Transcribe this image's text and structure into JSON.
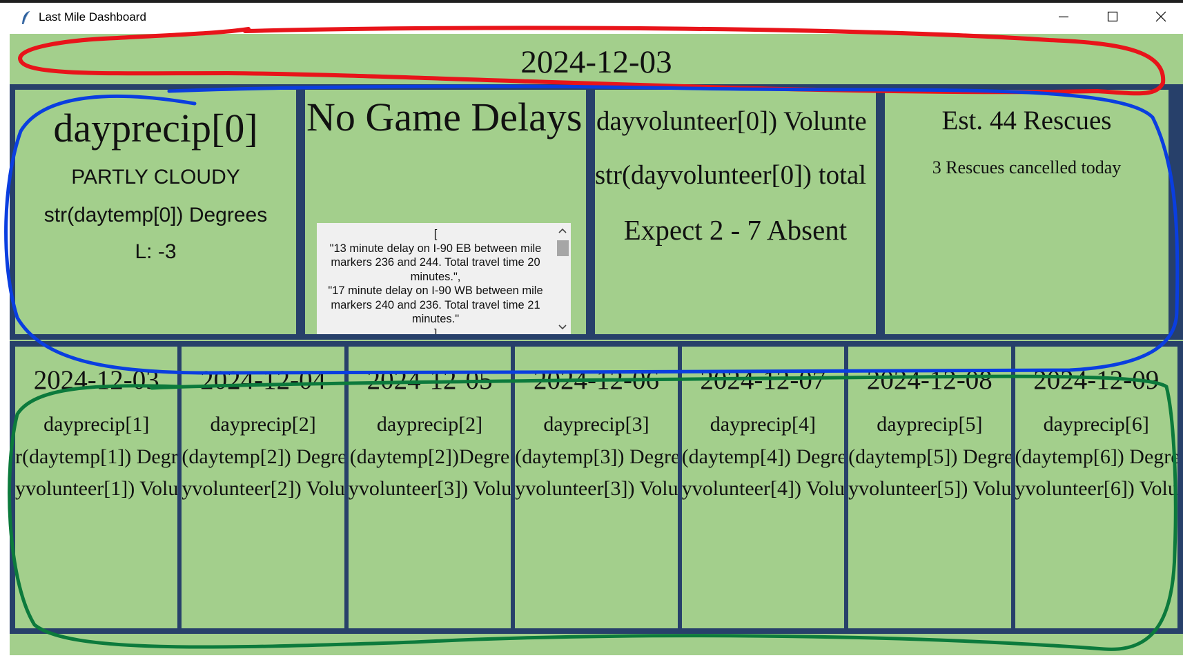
{
  "window": {
    "title": "Last Mile Dashboard",
    "controls": [
      "minimize-icon",
      "maximize-icon",
      "close-icon"
    ]
  },
  "header": {
    "date": "2024-12-03"
  },
  "weather": {
    "precip": "dayprecip[0]",
    "condition": "PARTLY CLOUDY",
    "temp": "str(daytemp[0]) Degrees",
    "low": "L: -3"
  },
  "traffic": {
    "title": "No Game Delays",
    "details": "[\n\"13 minute delay on I-90 EB between mile markers 236 and 244. Total travel time 20 minutes.\",\n\"17 minute delay on I-90 WB between mile markers 240 and 236. Total travel time 21 minutes.\"\n]"
  },
  "volunteers": {
    "line1": "dayvolunteer[0]) Volunte",
    "line2": "str(dayvolunteer[0]) total",
    "line3": "Expect 2 - 7 Absent"
  },
  "rescues": {
    "estimate": "Est. 44 Rescues",
    "cancelled": "3 Rescues cancelled today"
  },
  "forecast": [
    {
      "date": "2024-12-03",
      "precip": "dayprecip[1]",
      "temp": "r(daytemp[1]) Degre",
      "volunteer": "yvolunteer[1]) Volu"
    },
    {
      "date": "2024-12-04",
      "precip": "dayprecip[2]",
      "temp": "(daytemp[2]) Degre",
      "volunteer": "yvolunteer[2]) Volu"
    },
    {
      "date": "2024-12-05",
      "precip": "dayprecip[2]",
      "temp": "(daytemp[2])Degre",
      "volunteer": "yvolunteer[3]) Volu"
    },
    {
      "date": "2024-12-06",
      "precip": "dayprecip[3]",
      "temp": "(daytemp[3]) Degre",
      "volunteer": "yvolunteer[3]) Volu"
    },
    {
      "date": "2024-12-07",
      "precip": "dayprecip[4]",
      "temp": "(daytemp[4]) Degre",
      "volunteer": "yvolunteer[4]) Volu"
    },
    {
      "date": "2024-12-08",
      "precip": "dayprecip[5]",
      "temp": "(daytemp[5]) Degre",
      "volunteer": "yvolunteer[5]) Volu"
    },
    {
      "date": "2024-12-09",
      "precip": "dayprecip[6]",
      "temp": "(daytemp[6]) Degre",
      "volunteer": "yvolunteer[6]) Volu"
    }
  ],
  "colors": {
    "panel_background": "#a3cf8c",
    "border": "#27406a",
    "annotation_red": "#e8141a",
    "annotation_blue": "#0a3ee0",
    "annotation_green": "#0c7a3c"
  }
}
